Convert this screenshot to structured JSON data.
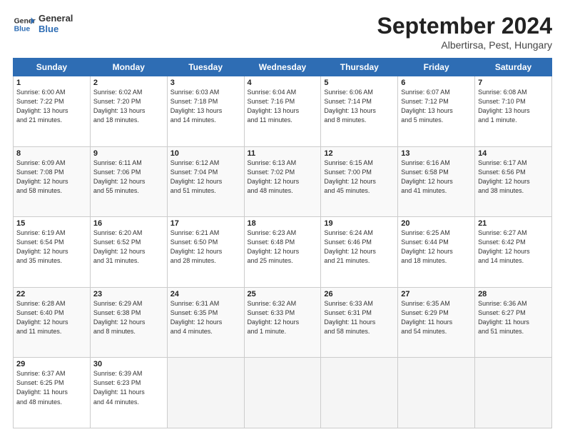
{
  "logo": {
    "line1": "General",
    "line2": "Blue"
  },
  "title": "September 2024",
  "subtitle": "Albertirsa, Pest, Hungary",
  "header_days": [
    "Sunday",
    "Monday",
    "Tuesday",
    "Wednesday",
    "Thursday",
    "Friday",
    "Saturday"
  ],
  "weeks": [
    [
      {
        "day": "1",
        "info": "Sunrise: 6:00 AM\nSunset: 7:22 PM\nDaylight: 13 hours\nand 21 minutes."
      },
      {
        "day": "2",
        "info": "Sunrise: 6:02 AM\nSunset: 7:20 PM\nDaylight: 13 hours\nand 18 minutes."
      },
      {
        "day": "3",
        "info": "Sunrise: 6:03 AM\nSunset: 7:18 PM\nDaylight: 13 hours\nand 14 minutes."
      },
      {
        "day": "4",
        "info": "Sunrise: 6:04 AM\nSunset: 7:16 PM\nDaylight: 13 hours\nand 11 minutes."
      },
      {
        "day": "5",
        "info": "Sunrise: 6:06 AM\nSunset: 7:14 PM\nDaylight: 13 hours\nand 8 minutes."
      },
      {
        "day": "6",
        "info": "Sunrise: 6:07 AM\nSunset: 7:12 PM\nDaylight: 13 hours\nand 5 minutes."
      },
      {
        "day": "7",
        "info": "Sunrise: 6:08 AM\nSunset: 7:10 PM\nDaylight: 13 hours\nand 1 minute."
      }
    ],
    [
      {
        "day": "8",
        "info": "Sunrise: 6:09 AM\nSunset: 7:08 PM\nDaylight: 12 hours\nand 58 minutes."
      },
      {
        "day": "9",
        "info": "Sunrise: 6:11 AM\nSunset: 7:06 PM\nDaylight: 12 hours\nand 55 minutes."
      },
      {
        "day": "10",
        "info": "Sunrise: 6:12 AM\nSunset: 7:04 PM\nDaylight: 12 hours\nand 51 minutes."
      },
      {
        "day": "11",
        "info": "Sunrise: 6:13 AM\nSunset: 7:02 PM\nDaylight: 12 hours\nand 48 minutes."
      },
      {
        "day": "12",
        "info": "Sunrise: 6:15 AM\nSunset: 7:00 PM\nDaylight: 12 hours\nand 45 minutes."
      },
      {
        "day": "13",
        "info": "Sunrise: 6:16 AM\nSunset: 6:58 PM\nDaylight: 12 hours\nand 41 minutes."
      },
      {
        "day": "14",
        "info": "Sunrise: 6:17 AM\nSunset: 6:56 PM\nDaylight: 12 hours\nand 38 minutes."
      }
    ],
    [
      {
        "day": "15",
        "info": "Sunrise: 6:19 AM\nSunset: 6:54 PM\nDaylight: 12 hours\nand 35 minutes."
      },
      {
        "day": "16",
        "info": "Sunrise: 6:20 AM\nSunset: 6:52 PM\nDaylight: 12 hours\nand 31 minutes."
      },
      {
        "day": "17",
        "info": "Sunrise: 6:21 AM\nSunset: 6:50 PM\nDaylight: 12 hours\nand 28 minutes."
      },
      {
        "day": "18",
        "info": "Sunrise: 6:23 AM\nSunset: 6:48 PM\nDaylight: 12 hours\nand 25 minutes."
      },
      {
        "day": "19",
        "info": "Sunrise: 6:24 AM\nSunset: 6:46 PM\nDaylight: 12 hours\nand 21 minutes."
      },
      {
        "day": "20",
        "info": "Sunrise: 6:25 AM\nSunset: 6:44 PM\nDaylight: 12 hours\nand 18 minutes."
      },
      {
        "day": "21",
        "info": "Sunrise: 6:27 AM\nSunset: 6:42 PM\nDaylight: 12 hours\nand 14 minutes."
      }
    ],
    [
      {
        "day": "22",
        "info": "Sunrise: 6:28 AM\nSunset: 6:40 PM\nDaylight: 12 hours\nand 11 minutes."
      },
      {
        "day": "23",
        "info": "Sunrise: 6:29 AM\nSunset: 6:38 PM\nDaylight: 12 hours\nand 8 minutes."
      },
      {
        "day": "24",
        "info": "Sunrise: 6:31 AM\nSunset: 6:35 PM\nDaylight: 12 hours\nand 4 minutes."
      },
      {
        "day": "25",
        "info": "Sunrise: 6:32 AM\nSunset: 6:33 PM\nDaylight: 12 hours\nand 1 minute."
      },
      {
        "day": "26",
        "info": "Sunrise: 6:33 AM\nSunset: 6:31 PM\nDaylight: 11 hours\nand 58 minutes."
      },
      {
        "day": "27",
        "info": "Sunrise: 6:35 AM\nSunset: 6:29 PM\nDaylight: 11 hours\nand 54 minutes."
      },
      {
        "day": "28",
        "info": "Sunrise: 6:36 AM\nSunset: 6:27 PM\nDaylight: 11 hours\nand 51 minutes."
      }
    ],
    [
      {
        "day": "29",
        "info": "Sunrise: 6:37 AM\nSunset: 6:25 PM\nDaylight: 11 hours\nand 48 minutes."
      },
      {
        "day": "30",
        "info": "Sunrise: 6:39 AM\nSunset: 6:23 PM\nDaylight: 11 hours\nand 44 minutes."
      },
      {
        "day": "",
        "info": ""
      },
      {
        "day": "",
        "info": ""
      },
      {
        "day": "",
        "info": ""
      },
      {
        "day": "",
        "info": ""
      },
      {
        "day": "",
        "info": ""
      }
    ]
  ]
}
